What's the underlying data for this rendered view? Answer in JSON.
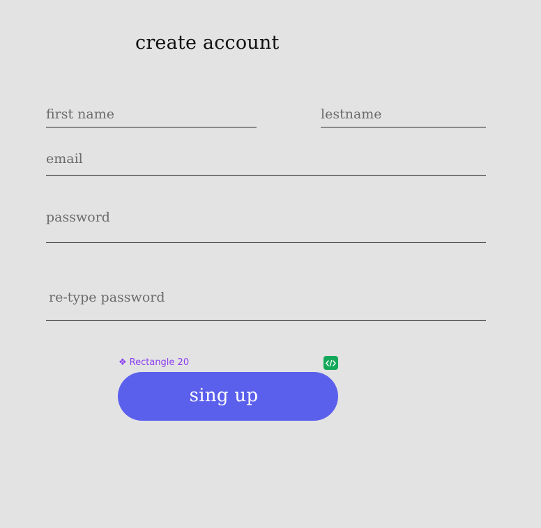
{
  "page": {
    "title": "create account"
  },
  "form": {
    "first_name": {
      "value": "",
      "placeholder": "first name"
    },
    "last_name": {
      "value": "",
      "placeholder": "lestname"
    },
    "email": {
      "value": "",
      "placeholder": "email"
    },
    "password": {
      "value": "",
      "placeholder": "password"
    },
    "retype_password": {
      "value": "",
      "placeholder": "re-type password"
    }
  },
  "design_overlay": {
    "component_icon": "component-diamond-icon",
    "component_label": "Rectangle 20",
    "component_color": "#8b3ff0",
    "code_icon": "code-brackets-icon",
    "code_badge_color": "#14a85a"
  },
  "actions": {
    "signup_label": "sing up",
    "signup_color": "#5b60ec"
  },
  "colors": {
    "background": "#e3e3e3"
  }
}
